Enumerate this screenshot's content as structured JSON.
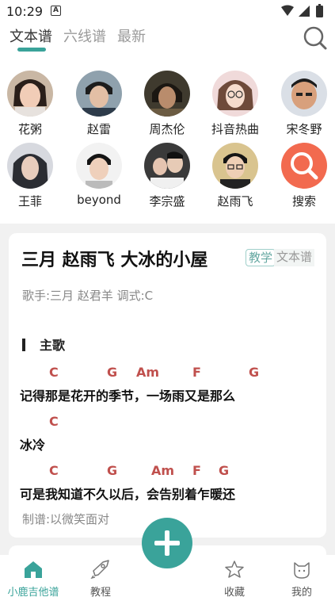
{
  "status_bar": {
    "time": "10:29",
    "notification_glyph": "A"
  },
  "top_tabs": [
    {
      "label": "文本谱",
      "active": true
    },
    {
      "label": "六线谱",
      "active": false
    },
    {
      "label": "最新",
      "active": false
    }
  ],
  "artists": [
    {
      "name": "花粥"
    },
    {
      "name": "赵雷"
    },
    {
      "name": "周杰伦"
    },
    {
      "name": "抖音热曲"
    },
    {
      "name": "宋冬野"
    },
    {
      "name": "王菲"
    },
    {
      "name": "beyond"
    },
    {
      "name": "李宗盛"
    },
    {
      "name": "赵雨飞"
    },
    {
      "name": "搜索"
    }
  ],
  "song_card": {
    "title": "三月 赵雨飞 大冰的小屋",
    "tags": [
      "教学",
      "文本谱"
    ],
    "meta": "歌手:三月 赵君羊  调式:C",
    "section": "主歌",
    "lines": [
      {
        "chords": [
          "C",
          "G",
          "Am",
          "F",
          "G"
        ],
        "lyric": "记得那是花开的季节，一场雨又是那么"
      },
      {
        "chords": [
          "C"
        ],
        "lyric": "冰冷"
      },
      {
        "chords": [
          "C",
          "G",
          "Am",
          "F",
          "G"
        ],
        "lyric": "可是我知道不久以后，会告别着乍暖还"
      }
    ],
    "credit": "制谱:以微笑面对"
  },
  "bottom_nav": [
    {
      "label": "小鹿吉他谱",
      "icon": "home-icon",
      "active": true
    },
    {
      "label": "教程",
      "icon": "rocket-icon",
      "active": false
    },
    {
      "label": "收藏",
      "icon": "star-icon",
      "active": false
    },
    {
      "label": "我的",
      "icon": "cat-icon",
      "active": false
    }
  ],
  "colors": {
    "accent": "#3aa39a",
    "chord": "#c0504d"
  }
}
